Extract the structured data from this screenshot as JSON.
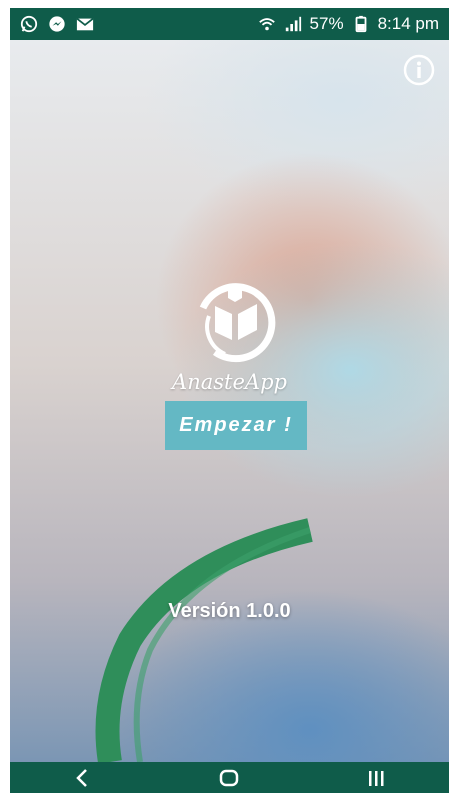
{
  "status_bar": {
    "battery": "57%",
    "time": "8:14 pm",
    "icons": [
      "whatsapp-icon",
      "messenger-icon",
      "gmail-icon",
      "wifi-icon",
      "signal-icon",
      "battery-icon"
    ]
  },
  "hero": {
    "app_name": "AnasteApp",
    "start_label": "Empezar !",
    "version": "Versión  1.0.0",
    "icons": [
      "info-icon",
      "app-logo-icon"
    ]
  },
  "nav_bar": {
    "icons": [
      "back-icon",
      "home-icon",
      "recent-apps-icon"
    ]
  },
  "colors": {
    "bars": "#0f5c4a",
    "button": "#64b8c4"
  }
}
